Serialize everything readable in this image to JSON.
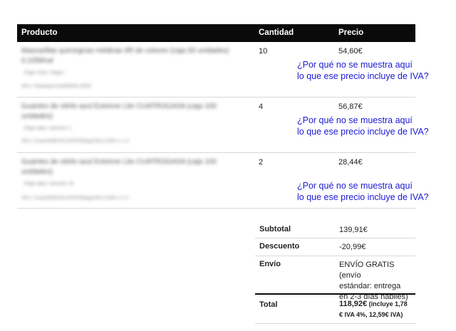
{
  "table": {
    "headers": {
      "product": "Producto",
      "quantity": "Cantidad",
      "price": "Precio"
    },
    "items": [
      {
        "name_line1": "Mascarillas quirúrgicas médicas IIR de colores (caja 50 unidades)",
        "name_line2": "0,1058/ud",
        "option": "Elige color: Negro",
        "sku": "SKU: MaskquirmedIIRNG-0005",
        "quantity": "10",
        "price": "54,60€"
      },
      {
        "name_line1": "Guantes de nitrilo azul Extreme Lite CUATROGASA (caja 100",
        "name_line2": "unidades)",
        "option": "Elige talla / tamaño: L",
        "sku": "SKU: GuantNitExtCUATROMag100u-0180-1-1-3",
        "quantity": "4",
        "price": "56,87€"
      },
      {
        "name_line1": "Guantes de nitrilo azul Extreme Lite CUATROGASA (caja 100",
        "name_line2": "unidades)",
        "option": "Elige talla / tamaño: M",
        "sku": "SKU: GuantNitExtCUATROMag100u-0180-1-1-2",
        "quantity": "2",
        "price": "28,44€"
      }
    ]
  },
  "annotation": {
    "line1": "¿Por qué no se muestra aquí",
    "line2": "lo que ese precio incluye de IVA?"
  },
  "totals": {
    "subtotal_label": "Subtotal",
    "subtotal_value": "139,91€",
    "discount_label": "Descuento",
    "discount_value": "-20,99€",
    "shipping_label": "Envío",
    "shipping_line1": "ENVÍO GRATIS (envío",
    "shipping_line2": "estándar: entrega",
    "shipping_line3": "en 2-3 días hábiles)",
    "total_label": "Total",
    "total_value": "118,92€",
    "total_note1": " (incluye 1,78",
    "total_note2": "€ IVA 4%, 12,59€ IVA)"
  }
}
